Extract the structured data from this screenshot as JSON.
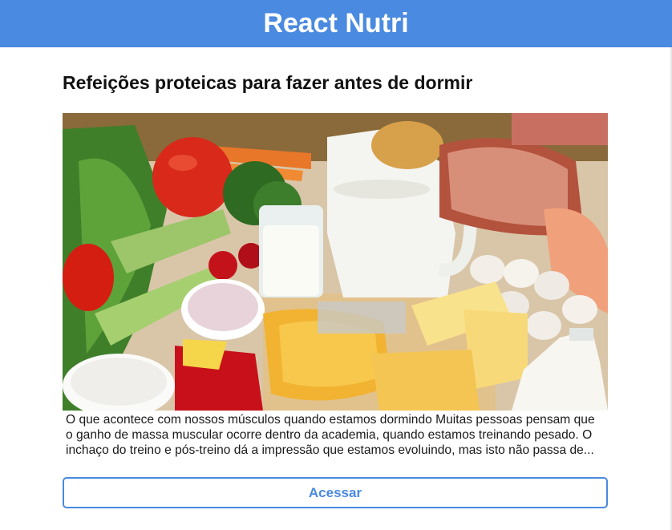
{
  "header": {
    "title": "React Nutri"
  },
  "post": {
    "title": "Refeições proteicas para fazer antes de dormir",
    "image_description_icon": "food-photo-icon",
    "excerpt": "O que acontece com nossos músculos quando estamos dormindo Muitas pessoas pensam que o ganho de massa muscular ocorre dentro da academia, quando estamos treinando pesado. O inchaço do treino e pós-treino dá a impressão que estamos evoluindo, mas isto não passa de...",
    "button_label": "Acessar"
  },
  "colors": {
    "header_bg": "#4a8ae0",
    "accent": "#4a8ae0",
    "text": "#111111"
  }
}
